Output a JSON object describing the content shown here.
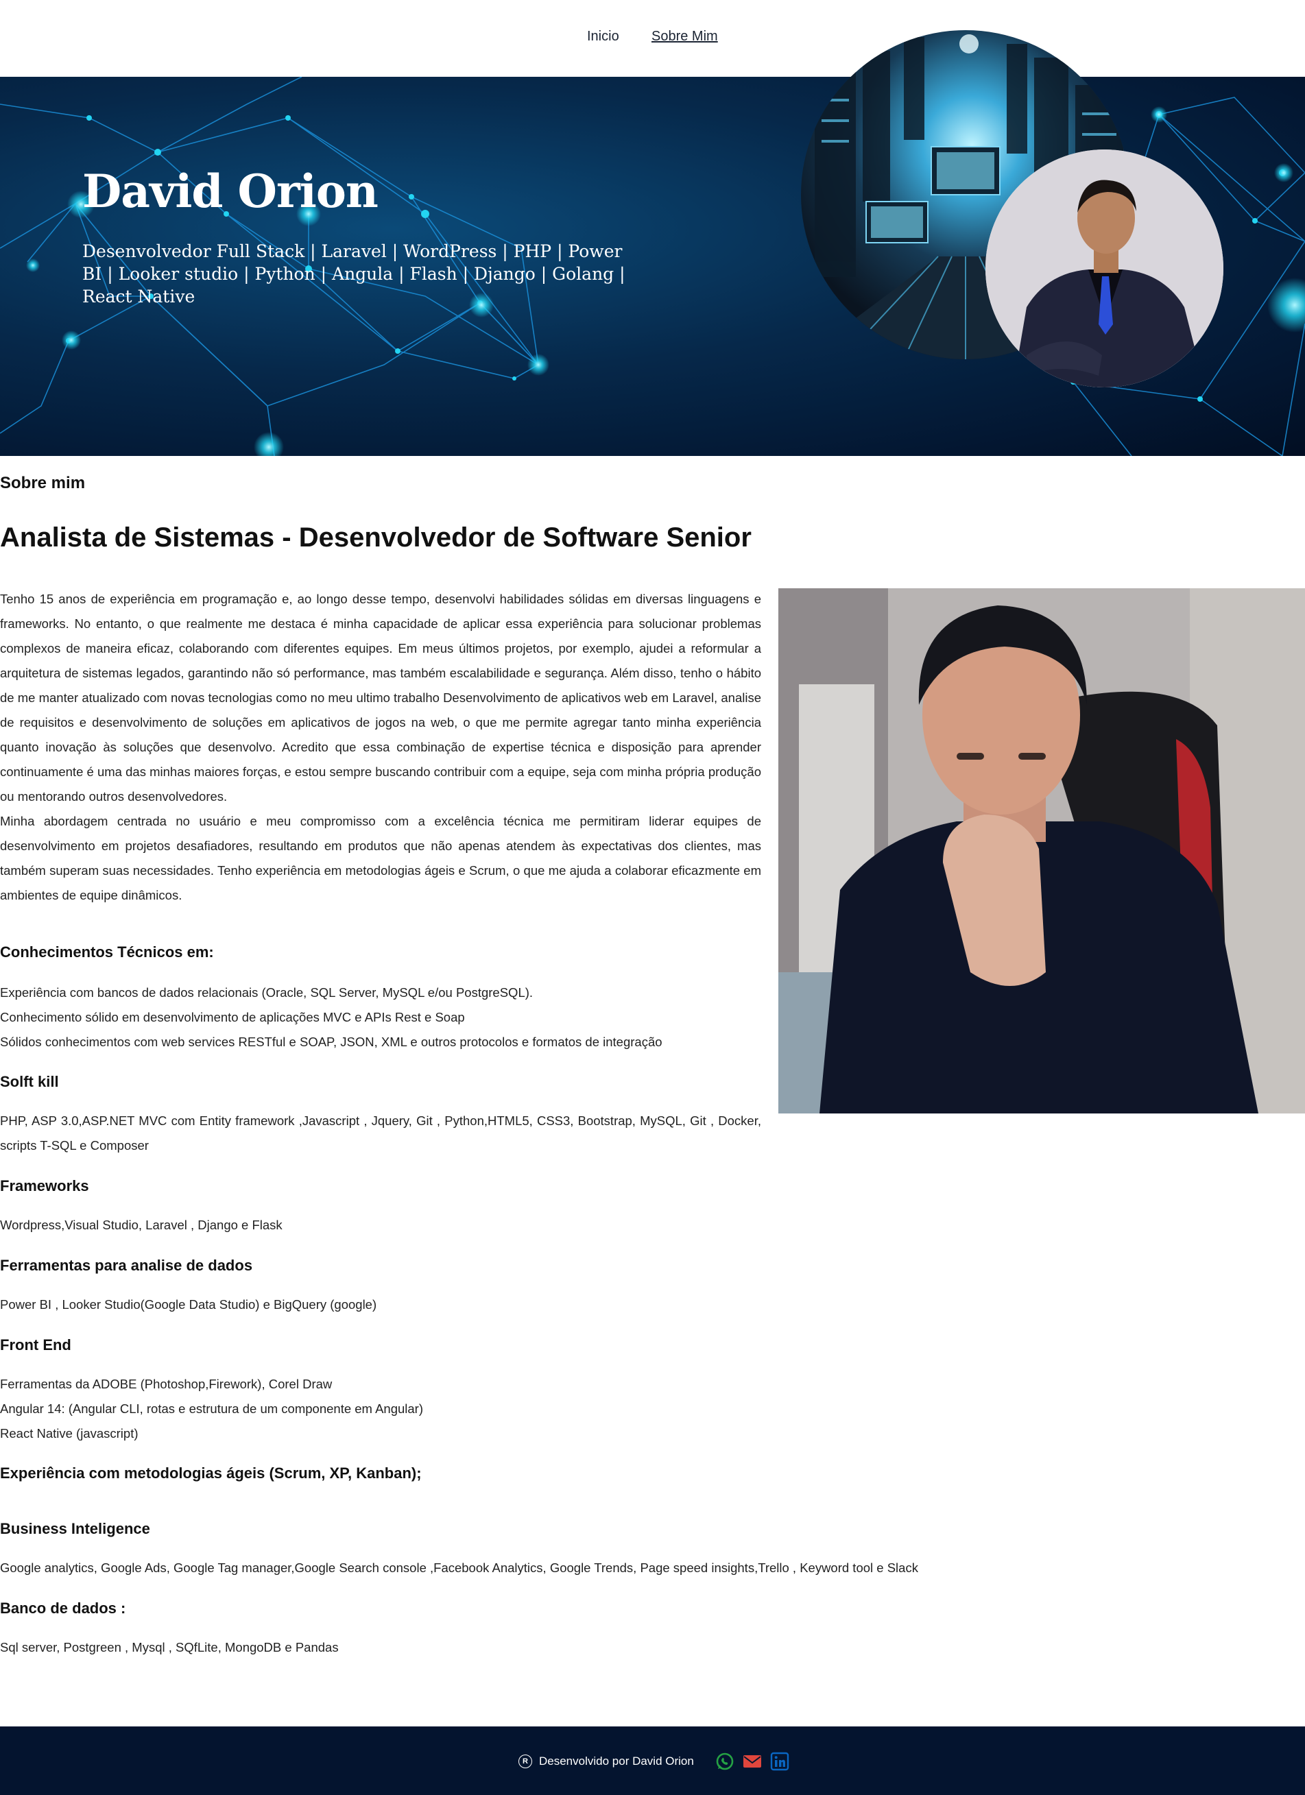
{
  "nav": {
    "home": "Inicio",
    "about": "Sobre Mim"
  },
  "hero": {
    "name": "David Orion",
    "subtitle": "Desenvolvedor Full Stack | Laravel | WordPress | PHP | Power BI | Looker studio | Python | Angula | Flash | Django | Golang | React Native"
  },
  "about": {
    "label": "Sobre mim",
    "title": "Analista de Sistemas - Desenvolvedor de Software Senior",
    "paragraph1": "Tenho 15 anos de experiência em programação e, ao longo desse tempo, desenvolvi habilidades sólidas em diversas linguagens e frameworks. No entanto, o que realmente me destaca é minha capacidade de aplicar essa experiência para solucionar problemas complexos de maneira eficaz, colaborando com diferentes equipes. Em meus últimos projetos, por exemplo, ajudei a reformular a arquitetura de sistemas legados, garantindo não só performance, mas também escalabilidade e segurança. Além disso, tenho o hábito de me manter atualizado com novas tecnologias como no meu ultimo trabalho Desenvolvimento de aplicativos web em Laravel, analise de requisitos e desenvolvimento de soluções em aplicativos de jogos na web, o que me permite agregar tanto minha experiência quanto inovação às soluções que desenvolvo. Acredito que essa combinação de expertise técnica e disposição para aprender continuamente é uma das minhas maiores forças, e estou sempre buscando contribuir com a equipe, seja com minha própria produção ou mentorando outros desenvolvedores.",
    "paragraph2": "Minha abordagem centrada no usuário e meu compromisso com a excelência técnica me permitiram liderar equipes de desenvolvimento em projetos desafiadores, resultando em produtos que não apenas atendem às expectativas dos clientes, mas também superam suas necessidades. Tenho experiência em metodologias ágeis e Scrum, o que me ajuda a colaborar eficazmente em ambientes de equipe dinâmicos."
  },
  "sections": {
    "tech": {
      "title": "Conhecimentos Técnicos em:",
      "items": [
        "Experiência com bancos de dados relacionais (Oracle, SQL Server, MySQL e/ou PostgreSQL).",
        "Conhecimento sólido em desenvolvimento de aplicações MVC e APIs Rest e Soap",
        "Sólidos conhecimentos com web services RESTful e SOAP, JSON, XML e outros protocolos e formatos de integração"
      ]
    },
    "soft": {
      "title": "Solft kill",
      "text": "PHP, ASP 3.0,ASP.NET MVC com Entity framework ,Javascript , Jquery, Git , Python,HTML5, CSS3, Bootstrap, MySQL, Git , Docker, scripts T-SQL e Composer"
    },
    "frameworks": {
      "title": "Frameworks",
      "text": "Wordpress,Visual Studio, Laravel , Django e Flask"
    },
    "data_tools": {
      "title": "Ferramentas para analise de dados",
      "text": "Power BI , Looker Studio(Google Data Studio) e BigQuery (google)"
    },
    "frontend": {
      "title": "Front End",
      "items": [
        "Ferramentas da ADOBE (Photoshop,Firework), Corel Draw",
        "Angular 14: (Angular CLI, rotas e estrutura de um componente em Angular)",
        "React Native (javascript)"
      ]
    },
    "agile": {
      "title": "Experiência com metodologias ágeis (Scrum, XP, Kanban);"
    },
    "bi": {
      "title": "Business Inteligence",
      "text": "Google analytics, Google Ads, Google Tag manager,Google Search console ,Facebook Analytics, Google Trends, Page speed insights,Trello , Keyword tool e Slack"
    },
    "db": {
      "title": "Banco de dados :",
      "text": "Sql server, Postgreen , Mysql , SQfLite, MongoDB e Pandas"
    }
  },
  "footer": {
    "credit": "Desenvolvido por David Orion",
    "icons": [
      "whatsapp-icon",
      "email-icon",
      "linkedin-icon"
    ]
  },
  "colors": {
    "hero_bg": "#06284a",
    "footer_bg": "#04142f",
    "whatsapp": "#25a244",
    "email": "#e0463d",
    "linkedin": "#0a66c2"
  }
}
